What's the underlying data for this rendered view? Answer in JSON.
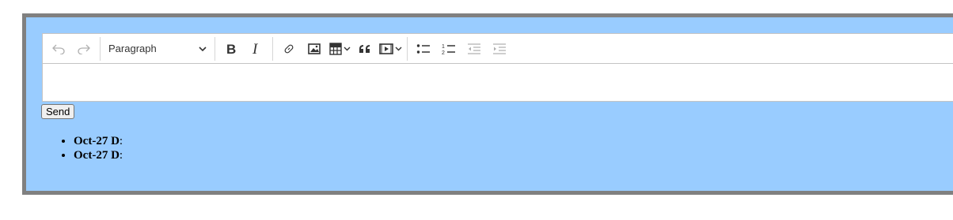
{
  "toolbar": {
    "heading_value": "Paragraph"
  },
  "send_label": "Send",
  "messages": [
    {
      "date": "Oct-27 D",
      "suffix": ":"
    },
    {
      "date": "Oct-27 D",
      "suffix": ":"
    }
  ],
  "colors": {
    "frame_background": "#99ccff",
    "frame_border": "#808080"
  }
}
